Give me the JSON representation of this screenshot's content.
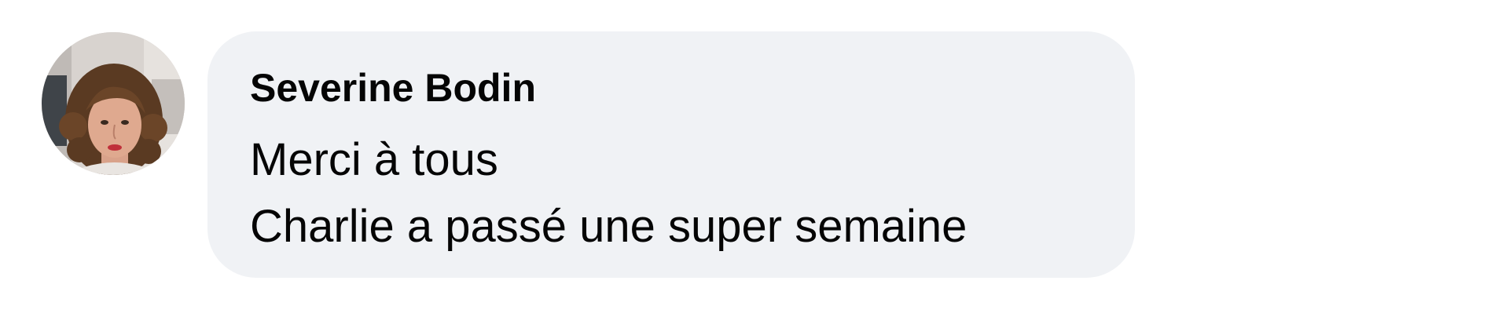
{
  "comment": {
    "author": "Severine Bodin",
    "lines": [
      "Merci à tous",
      "Charlie a passé une super semaine"
    ],
    "avatar_icon": "profile-photo",
    "bubble_color": "#f0f2f5",
    "text_color": "#050505"
  }
}
